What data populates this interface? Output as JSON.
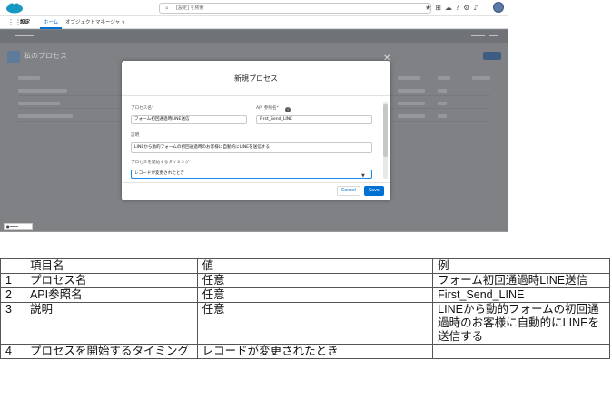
{
  "search": {
    "placeholder": "[設定] を検索"
  },
  "nav": {
    "app_name": "設定",
    "tab_home": "ホーム",
    "tab_object_manager": "オブジェクトマネージャ ∨"
  },
  "background": {
    "title": "私のプロセス"
  },
  "modal": {
    "title": "新規プロセス",
    "process_name_label": "プロセス名*",
    "process_name_value": "フォーム初回通過時LINE送信",
    "api_name_label": "API 参照名*",
    "api_name_value": "First_Send_LINE",
    "description_label": "説明",
    "description_value": "LINEから動的フォームの初回通過時のお客様に自動的にLINEを送信する",
    "start_label": "プロセスを開始するタイミング*",
    "start_value": "レコードが変更されたとき",
    "cancel_label": "Cancel",
    "save_label": "Save"
  },
  "table": {
    "headers": [
      "",
      "項目名",
      "値",
      "例"
    ],
    "rows": [
      {
        "no": "1",
        "name": "プロセス名",
        "value": "任意",
        "example": "フォーム初回通過時LINE送信"
      },
      {
        "no": "2",
        "name": "API参照名",
        "value": "任意",
        "example": "First_Send_LINE"
      },
      {
        "no": "3",
        "name": "説明",
        "value": "任意",
        "example": "LINEから動的フォームの初回通過時のお客様に自動的にLINEを送信する"
      },
      {
        "no": "4",
        "name": "プロセスを開始するタイミング",
        "value": "レコードが変更されたとき",
        "example": ""
      }
    ]
  },
  "colors": {
    "brand_blue": "#0070d2",
    "cloud": "#1798c1",
    "overlay": "#7f8184"
  }
}
